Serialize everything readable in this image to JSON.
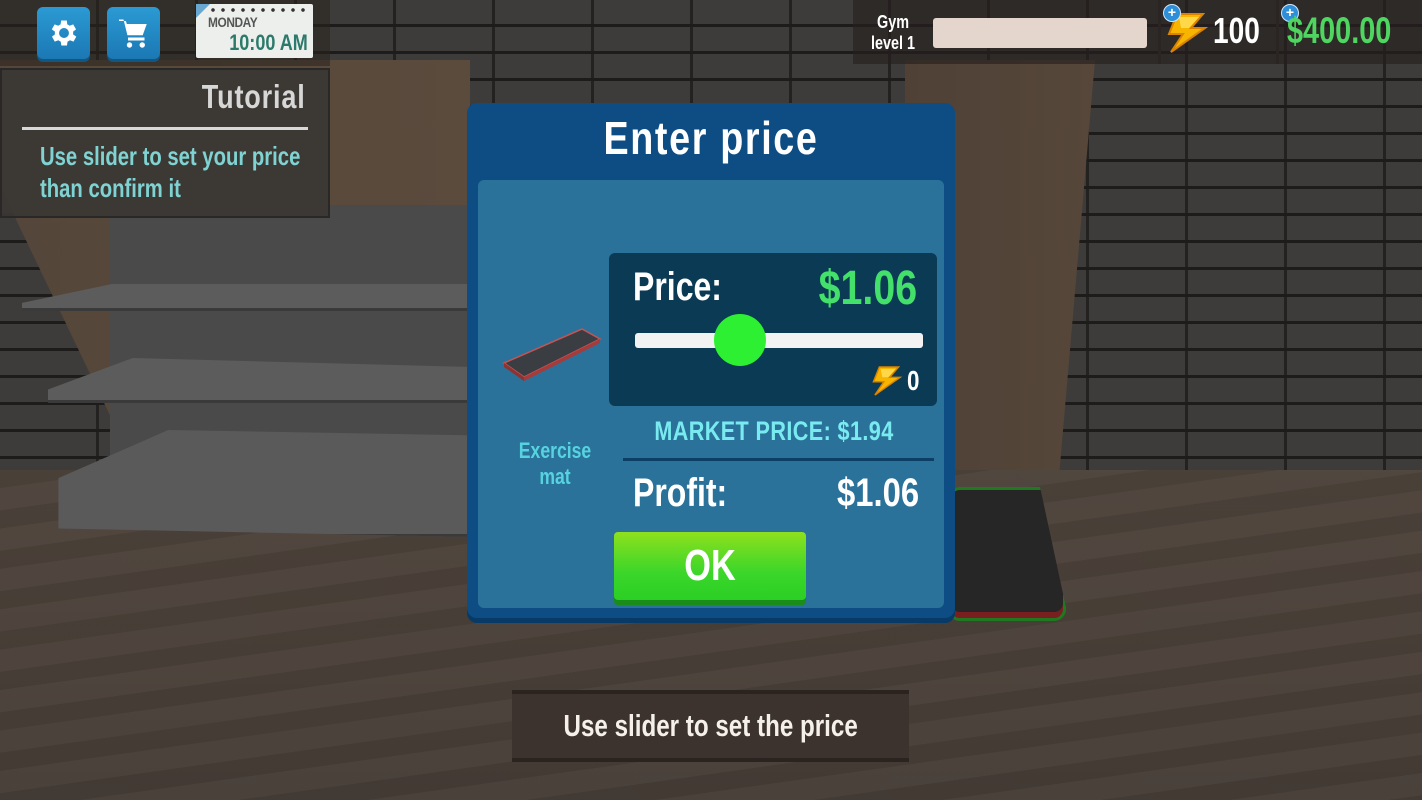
{
  "hud": {
    "settings_icon": "gear-icon",
    "cart_icon": "shopping-cart-icon",
    "calendar": {
      "day": "MONDAY",
      "time": "10:00 AM"
    },
    "gym_level": {
      "line1": "Gym",
      "line2": "level 1",
      "xp_progress": 0
    },
    "energy": {
      "value": "100",
      "icon": "lightning-bolt-icon",
      "add_icon": "plus-icon"
    },
    "money": {
      "value": "$400.00",
      "add_icon": "plus-icon"
    }
  },
  "tutorial": {
    "title": "Tutorial",
    "text": "Use slider to set your price than confirm it"
  },
  "dialog": {
    "title": "Enter price",
    "item": {
      "name": "Exercise mat",
      "icon": "exercise-mat-icon"
    },
    "price_label": "Price:",
    "price_value": "$1.06",
    "slider": {
      "min": 0,
      "max": 2.91,
      "value": 1.06,
      "fraction": 0.364
    },
    "energy_cost": "0",
    "market_price": "MARKET PRICE: $1.94",
    "profit_label": "Profit:",
    "profit_value": "$1.06",
    "ok_label": "OK"
  },
  "hint": {
    "text": "Use slider to set the price"
  },
  "colors": {
    "dialog_bg": "#0d4d83",
    "dialog_inner": "#2a7299",
    "price_green": "#43e06a",
    "money_green": "#4ed660",
    "slider_thumb": "#2ef032",
    "market_cyan": "#79ebf0",
    "tutorial_text": "#7fd3d2"
  }
}
